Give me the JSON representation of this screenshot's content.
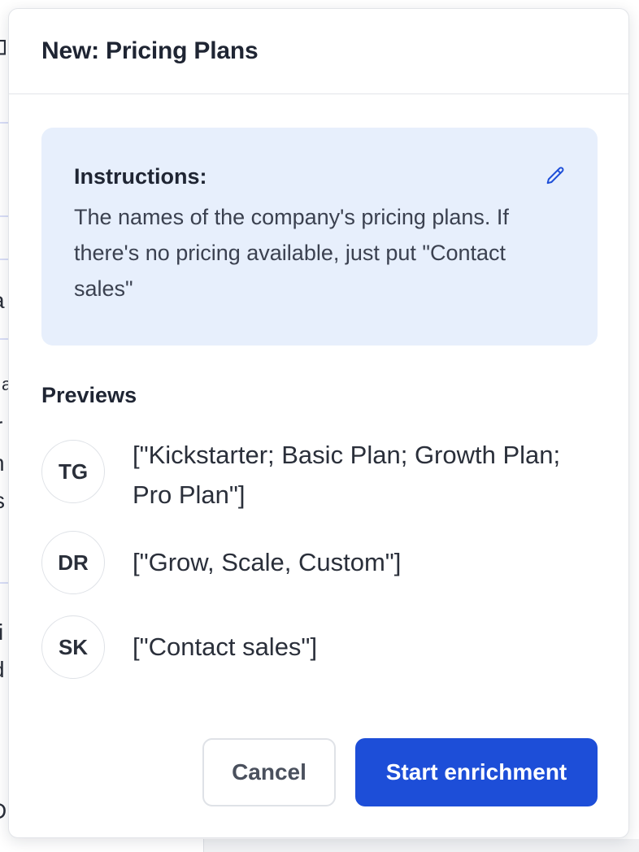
{
  "dialog": {
    "title": "New: Pricing Plans"
  },
  "instructions": {
    "heading": "Instructions:",
    "text": "The names of the company's pricing plans. If there's no pricing available, just put \"Contact sales\"",
    "edit_icon": "pencil-icon"
  },
  "previews": {
    "heading": "Previews",
    "items": [
      {
        "initials": "TG",
        "value": "[\"Kickstarter; Basic Plan; Growth Plan; Pro Plan\"]"
      },
      {
        "initials": "DR",
        "value": "[\"Grow, Scale, Custom\"]"
      },
      {
        "initials": "SK",
        "value": "[\"Contact sales\"]"
      }
    ]
  },
  "actions": {
    "cancel_label": "Cancel",
    "start_label": "Start enrichment"
  },
  "background_fragments": [
    "a",
    "a",
    "r",
    "n",
    "s",
    "i",
    "d",
    "D"
  ],
  "colors": {
    "accent": "#1d4ed8",
    "instructions_bg": "#e7effc",
    "text": "#1f2533"
  }
}
